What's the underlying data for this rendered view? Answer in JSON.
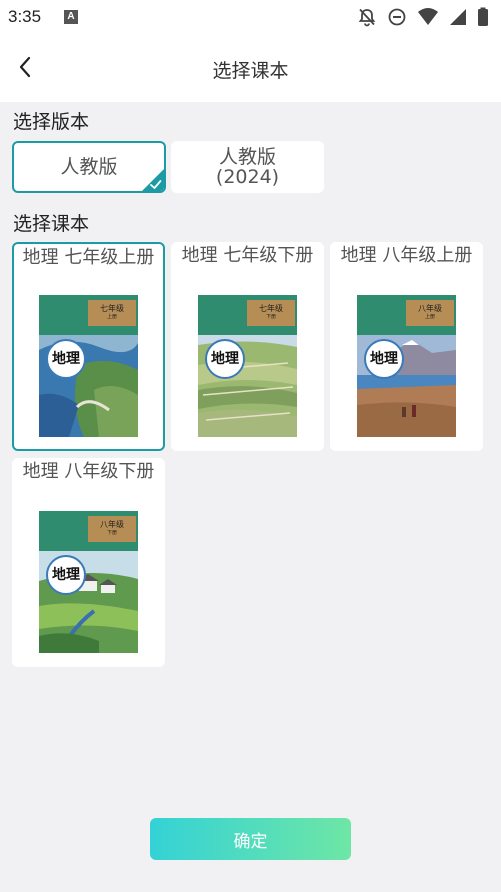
{
  "status_bar": {
    "time": "3:35",
    "notification_badge": "A"
  },
  "header": {
    "title": "选择课本"
  },
  "version_section": {
    "label": "选择版本",
    "options": [
      {
        "label": "人教版",
        "selected": true
      },
      {
        "label_line1": "人教版",
        "label_line2": "(2024)",
        "selected": false
      }
    ]
  },
  "textbook_section": {
    "label": "选择课本",
    "books": [
      {
        "title": "地理 七年级上册",
        "cover_grade": "七年级",
        "cover_volume": "上册",
        "cover_subject": "地理",
        "selected": true
      },
      {
        "title": "地理 七年级下册",
        "cover_grade": "七年级",
        "cover_volume": "下册",
        "cover_subject": "地理",
        "selected": false
      },
      {
        "title": "地理 八年级上册",
        "cover_grade": "八年级",
        "cover_volume": "上册",
        "cover_subject": "地理",
        "selected": false
      },
      {
        "title": "地理 八年级下册",
        "cover_grade": "八年级",
        "cover_volume": "下册",
        "cover_subject": "地理",
        "selected": false
      }
    ]
  },
  "confirm_label": "确定",
  "colors": {
    "accent": "#1d9ba5",
    "button_start": "#34d2d6",
    "button_end": "#6ee6a5",
    "background": "#f1f1f3"
  }
}
